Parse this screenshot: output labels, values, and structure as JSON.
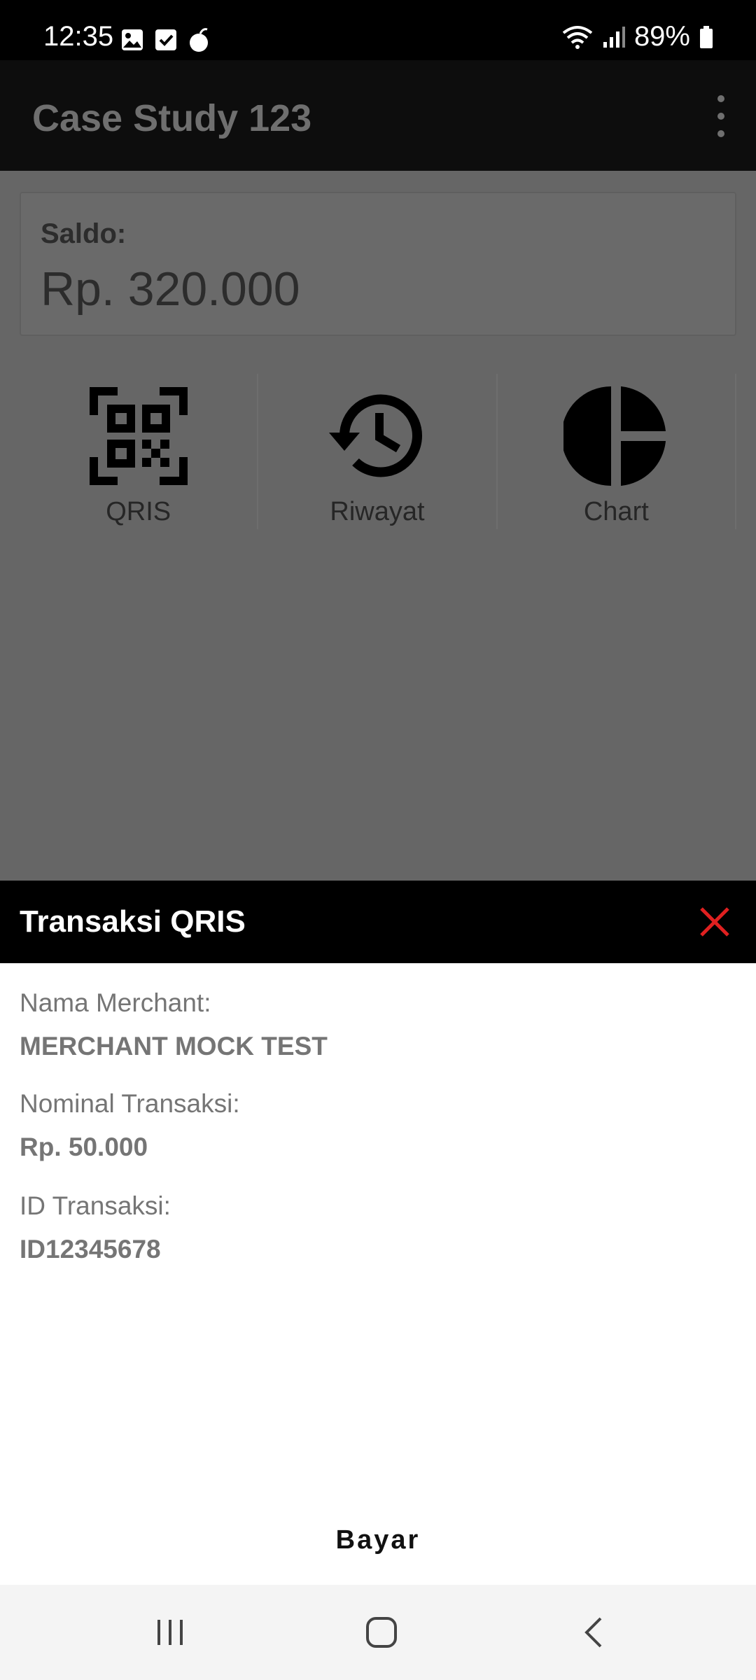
{
  "status_bar": {
    "time": "12:35",
    "battery": "89%",
    "left_icons": [
      "image-icon",
      "checkbox-icon",
      "bomb-icon"
    ],
    "right_icons": [
      "wifi-icon",
      "signal-icon",
      "battery-icon"
    ]
  },
  "app_bar": {
    "title": "Case Study 123",
    "menu_icon": "overflow-menu-icon"
  },
  "balance": {
    "label": "Saldo:",
    "value": "Rp. 320.000"
  },
  "menu": [
    {
      "label": "QRIS",
      "icon": "qr-code-icon"
    },
    {
      "label": "Riwayat",
      "icon": "history-icon"
    },
    {
      "label": "Chart",
      "icon": "pie-chart-icon"
    }
  ],
  "sheet": {
    "title": "Transaksi QRIS",
    "close_icon": "close-icon",
    "close_color": "#e02020",
    "fields": [
      {
        "label": "Nama Merchant:",
        "value": "MERCHANT MOCK TEST"
      },
      {
        "label": "Nominal Transaksi:",
        "value": "Rp. 50.000"
      },
      {
        "label": "ID Transaksi:",
        "value": "ID12345678"
      }
    ],
    "pay_button": "Bayar"
  },
  "nav_bar": {
    "icons": [
      "recent-apps-icon",
      "home-icon",
      "back-icon"
    ]
  }
}
